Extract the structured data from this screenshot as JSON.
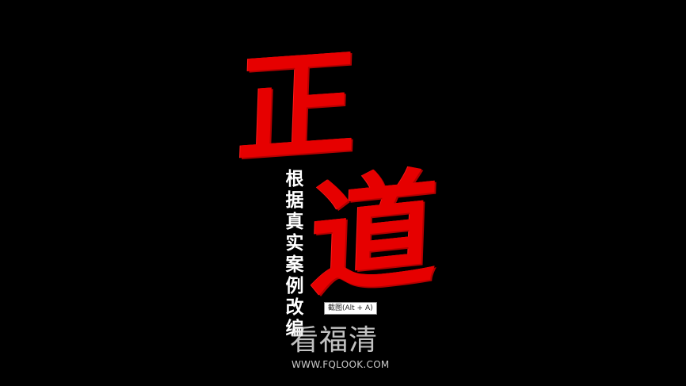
{
  "poster": {
    "title_char_1": "正",
    "title_char_2": "道",
    "subtitle_vertical": "根据真实案例改编"
  },
  "tooltip": {
    "text": "截图(Alt + A)"
  },
  "watermark": {
    "logo_text": "看福清",
    "url": "WWW.FQLOOK.COM"
  },
  "colors": {
    "background": "#000000",
    "title_red": "#e60000",
    "subtitle": "#ffffff"
  }
}
